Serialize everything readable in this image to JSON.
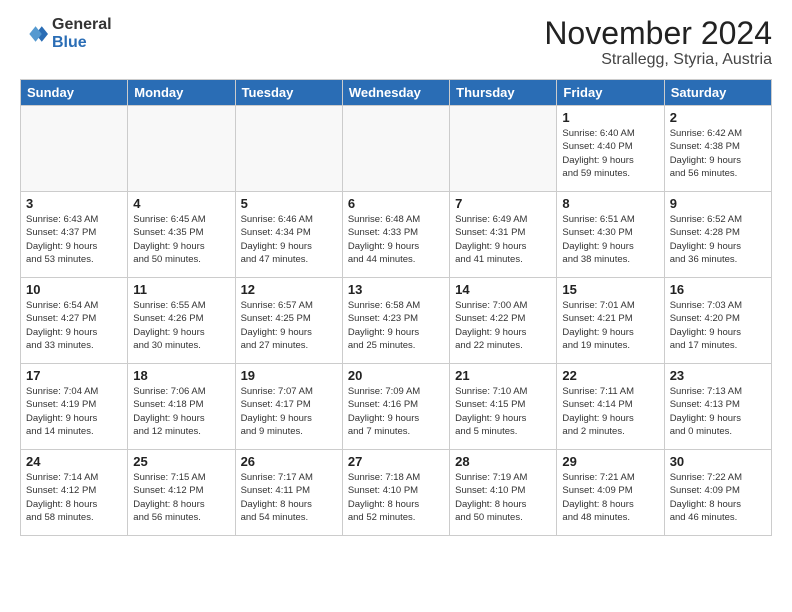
{
  "logo": {
    "general": "General",
    "blue": "Blue"
  },
  "title": "November 2024",
  "location": "Strallegg, Styria, Austria",
  "days_of_week": [
    "Sunday",
    "Monday",
    "Tuesday",
    "Wednesday",
    "Thursday",
    "Friday",
    "Saturday"
  ],
  "weeks": [
    [
      {
        "day": "",
        "info": ""
      },
      {
        "day": "",
        "info": ""
      },
      {
        "day": "",
        "info": ""
      },
      {
        "day": "",
        "info": ""
      },
      {
        "day": "",
        "info": ""
      },
      {
        "day": "1",
        "info": "Sunrise: 6:40 AM\nSunset: 4:40 PM\nDaylight: 9 hours\nand 59 minutes."
      },
      {
        "day": "2",
        "info": "Sunrise: 6:42 AM\nSunset: 4:38 PM\nDaylight: 9 hours\nand 56 minutes."
      }
    ],
    [
      {
        "day": "3",
        "info": "Sunrise: 6:43 AM\nSunset: 4:37 PM\nDaylight: 9 hours\nand 53 minutes."
      },
      {
        "day": "4",
        "info": "Sunrise: 6:45 AM\nSunset: 4:35 PM\nDaylight: 9 hours\nand 50 minutes."
      },
      {
        "day": "5",
        "info": "Sunrise: 6:46 AM\nSunset: 4:34 PM\nDaylight: 9 hours\nand 47 minutes."
      },
      {
        "day": "6",
        "info": "Sunrise: 6:48 AM\nSunset: 4:33 PM\nDaylight: 9 hours\nand 44 minutes."
      },
      {
        "day": "7",
        "info": "Sunrise: 6:49 AM\nSunset: 4:31 PM\nDaylight: 9 hours\nand 41 minutes."
      },
      {
        "day": "8",
        "info": "Sunrise: 6:51 AM\nSunset: 4:30 PM\nDaylight: 9 hours\nand 38 minutes."
      },
      {
        "day": "9",
        "info": "Sunrise: 6:52 AM\nSunset: 4:28 PM\nDaylight: 9 hours\nand 36 minutes."
      }
    ],
    [
      {
        "day": "10",
        "info": "Sunrise: 6:54 AM\nSunset: 4:27 PM\nDaylight: 9 hours\nand 33 minutes."
      },
      {
        "day": "11",
        "info": "Sunrise: 6:55 AM\nSunset: 4:26 PM\nDaylight: 9 hours\nand 30 minutes."
      },
      {
        "day": "12",
        "info": "Sunrise: 6:57 AM\nSunset: 4:25 PM\nDaylight: 9 hours\nand 27 minutes."
      },
      {
        "day": "13",
        "info": "Sunrise: 6:58 AM\nSunset: 4:23 PM\nDaylight: 9 hours\nand 25 minutes."
      },
      {
        "day": "14",
        "info": "Sunrise: 7:00 AM\nSunset: 4:22 PM\nDaylight: 9 hours\nand 22 minutes."
      },
      {
        "day": "15",
        "info": "Sunrise: 7:01 AM\nSunset: 4:21 PM\nDaylight: 9 hours\nand 19 minutes."
      },
      {
        "day": "16",
        "info": "Sunrise: 7:03 AM\nSunset: 4:20 PM\nDaylight: 9 hours\nand 17 minutes."
      }
    ],
    [
      {
        "day": "17",
        "info": "Sunrise: 7:04 AM\nSunset: 4:19 PM\nDaylight: 9 hours\nand 14 minutes."
      },
      {
        "day": "18",
        "info": "Sunrise: 7:06 AM\nSunset: 4:18 PM\nDaylight: 9 hours\nand 12 minutes."
      },
      {
        "day": "19",
        "info": "Sunrise: 7:07 AM\nSunset: 4:17 PM\nDaylight: 9 hours\nand 9 minutes."
      },
      {
        "day": "20",
        "info": "Sunrise: 7:09 AM\nSunset: 4:16 PM\nDaylight: 9 hours\nand 7 minutes."
      },
      {
        "day": "21",
        "info": "Sunrise: 7:10 AM\nSunset: 4:15 PM\nDaylight: 9 hours\nand 5 minutes."
      },
      {
        "day": "22",
        "info": "Sunrise: 7:11 AM\nSunset: 4:14 PM\nDaylight: 9 hours\nand 2 minutes."
      },
      {
        "day": "23",
        "info": "Sunrise: 7:13 AM\nSunset: 4:13 PM\nDaylight: 9 hours\nand 0 minutes."
      }
    ],
    [
      {
        "day": "24",
        "info": "Sunrise: 7:14 AM\nSunset: 4:12 PM\nDaylight: 8 hours\nand 58 minutes."
      },
      {
        "day": "25",
        "info": "Sunrise: 7:15 AM\nSunset: 4:12 PM\nDaylight: 8 hours\nand 56 minutes."
      },
      {
        "day": "26",
        "info": "Sunrise: 7:17 AM\nSunset: 4:11 PM\nDaylight: 8 hours\nand 54 minutes."
      },
      {
        "day": "27",
        "info": "Sunrise: 7:18 AM\nSunset: 4:10 PM\nDaylight: 8 hours\nand 52 minutes."
      },
      {
        "day": "28",
        "info": "Sunrise: 7:19 AM\nSunset: 4:10 PM\nDaylight: 8 hours\nand 50 minutes."
      },
      {
        "day": "29",
        "info": "Sunrise: 7:21 AM\nSunset: 4:09 PM\nDaylight: 8 hours\nand 48 minutes."
      },
      {
        "day": "30",
        "info": "Sunrise: 7:22 AM\nSunset: 4:09 PM\nDaylight: 8 hours\nand 46 minutes."
      }
    ]
  ]
}
